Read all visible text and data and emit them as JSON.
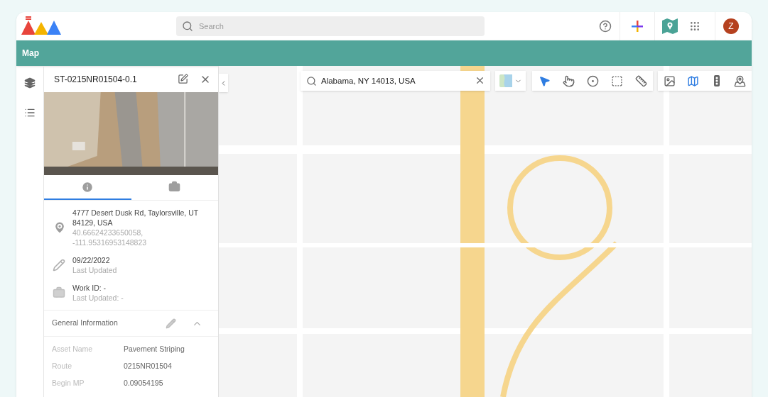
{
  "header": {
    "search": {
      "placeholder": "Search"
    },
    "avatar": "Z"
  },
  "page_title": "Map",
  "rail": [
    {
      "kind": "layers",
      "selected": false
    },
    {
      "kind": "list",
      "selected": false
    }
  ],
  "panel": {
    "title": "ST-0215NR01504-0.1",
    "tabs": [
      {
        "kind": "info",
        "selected": true
      },
      {
        "kind": "work",
        "selected": false
      }
    ],
    "details": [
      {
        "kind": "location",
        "primary": "4777 Desert Dusk Rd, Taylorsville, UT 84129, USA",
        "secondary": "40.66624233650058, -111.95316953148823"
      },
      {
        "kind": "edit",
        "primary": "09/22/2022",
        "secondary": "Last Updated"
      },
      {
        "kind": "work",
        "primary": "Work ID: -",
        "secondary": "Last Updated: -"
      }
    ],
    "general": {
      "title": "General Information",
      "expanded": true,
      "rows": [
        {
          "label": "Asset Name",
          "value": "Pavement Striping"
        },
        {
          "label": "Route",
          "value": "0215NR01504"
        },
        {
          "label": "Begin MP",
          "value": "0.09054195"
        }
      ]
    }
  },
  "map": {
    "search": {
      "value": "Alabama, NY 14013, USA"
    },
    "tools": [
      {
        "kind": "pointer",
        "selected": true
      },
      {
        "kind": "tap",
        "selected": false
      },
      {
        "kind": "radius",
        "selected": false
      },
      {
        "kind": "box",
        "selected": false
      },
      {
        "kind": "measure",
        "selected": false
      }
    ],
    "layers": [
      {
        "kind": "satellite",
        "selected": false
      },
      {
        "kind": "map",
        "selected": true
      },
      {
        "kind": "traffic",
        "selected": false
      },
      {
        "kind": "places",
        "selected": false
      }
    ]
  }
}
